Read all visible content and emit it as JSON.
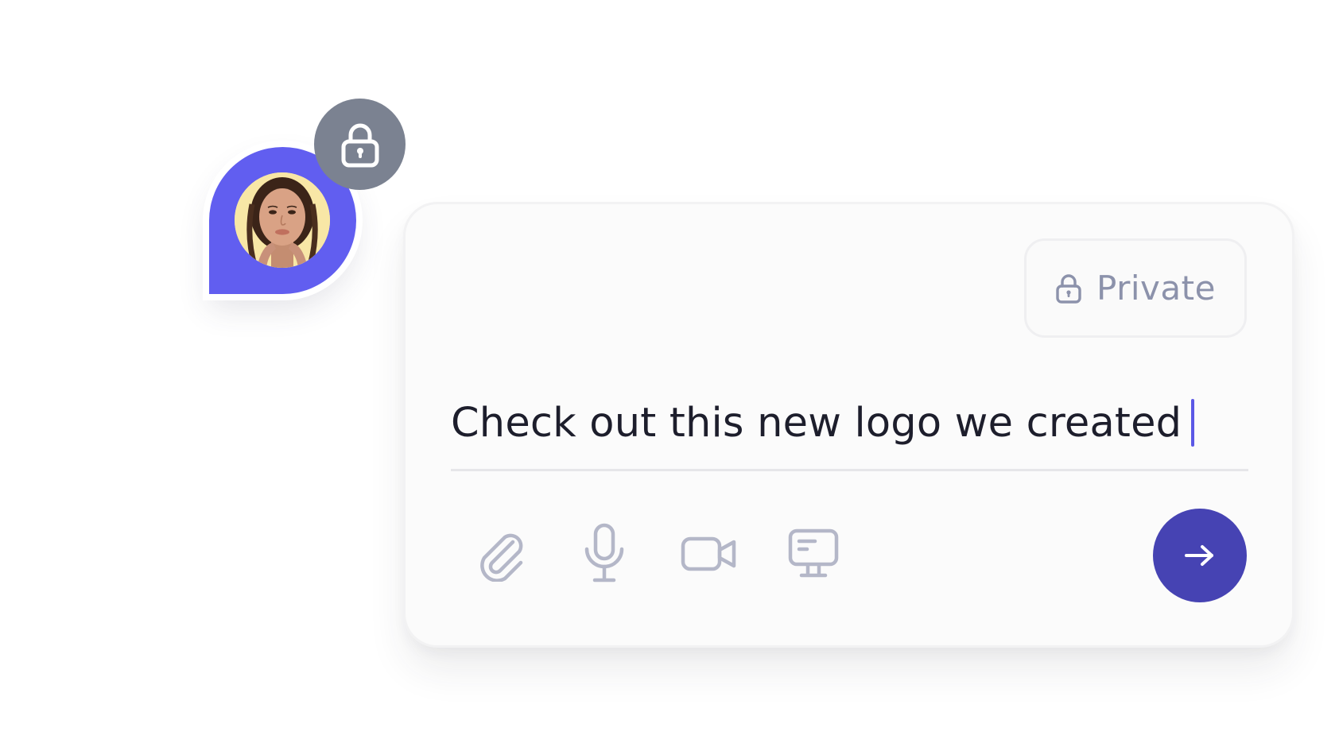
{
  "composer": {
    "privacy_label": "Private",
    "message": "Check out this new logo we created"
  },
  "icons": {
    "privacy_badge": "lock-icon",
    "privacy_chip": "lock-icon",
    "attach": "paperclip-icon",
    "microphone": "microphone-icon",
    "video": "video-camera-icon",
    "screen": "screen-share-icon",
    "send": "arrow-right-icon"
  },
  "colors": {
    "accent": "#615ef0",
    "send_button": "#4643b3",
    "caret": "#5b58e6",
    "badge": "#7b8291",
    "icon_muted": "#b4b7c8",
    "privacy_text": "#8c92ab",
    "message_text": "#1d1e2c"
  }
}
